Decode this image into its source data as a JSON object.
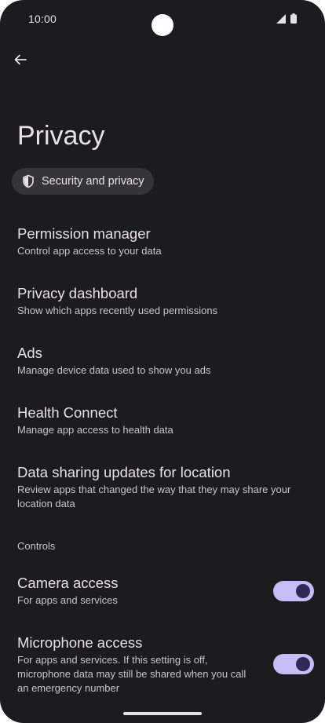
{
  "status_bar": {
    "time": "10:00",
    "icons": [
      "signal-icon",
      "battery-icon"
    ]
  },
  "header": {
    "back_icon": "arrow-left-icon",
    "title": "Privacy"
  },
  "chip": {
    "icon": "shield-icon",
    "label": "Security and privacy"
  },
  "items": [
    {
      "title": "Permission manager",
      "subtitle": "Control app access to your data"
    },
    {
      "title": "Privacy dashboard",
      "subtitle": "Show which apps recently used permissions"
    },
    {
      "title": "Ads",
      "subtitle": "Manage device data used to show you ads"
    },
    {
      "title": "Health Connect",
      "subtitle": "Manage app access to health data"
    },
    {
      "title": "Data sharing updates for location",
      "subtitle": "Review apps that changed the way that they may share your location data"
    }
  ],
  "controls": {
    "header": "Controls",
    "toggles": [
      {
        "title": "Camera access",
        "subtitle": "For apps and services",
        "on": true
      },
      {
        "title": "Microphone access",
        "subtitle": "For apps and services. If this setting is off, microphone data may still be shared when you call an emergency number",
        "on": true
      }
    ]
  },
  "colors": {
    "background": "#1c1b20",
    "switch_track": "#c4bdf6",
    "switch_thumb": "#2e2a57",
    "chip_background": "#36343b"
  }
}
